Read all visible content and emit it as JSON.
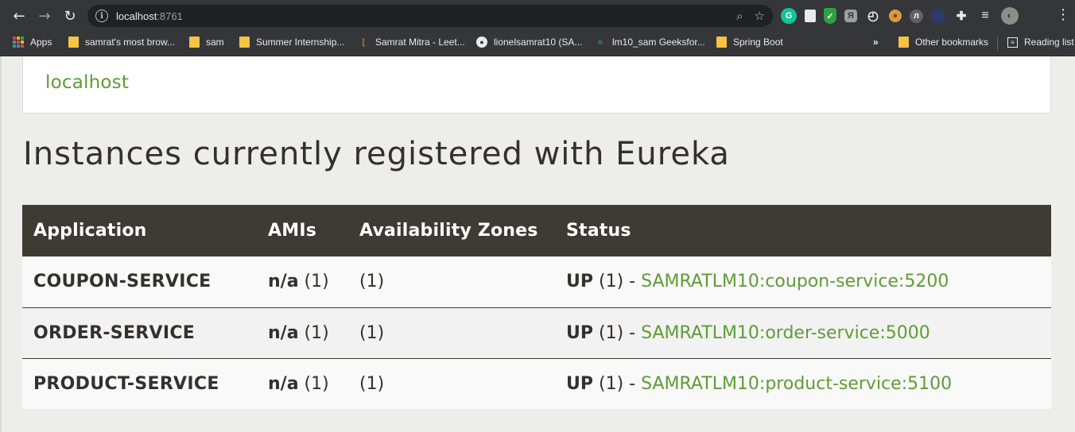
{
  "browser": {
    "url_host": "localhost",
    "url_port": ":8761",
    "extensions": [
      {
        "icon": "grammarly-icon",
        "color": "#15c39a",
        "glyph": "G"
      },
      {
        "icon": "notes-extension-icon",
        "color": "#e8eaed",
        "glyph": ""
      },
      {
        "icon": "shield-extension-icon",
        "color": "#2ea043",
        "glyph": "✓"
      },
      {
        "icon": "translate-extension-icon",
        "color": "#9aa0a6",
        "glyph": "Я"
      },
      {
        "icon": "timer-extension-icon",
        "color": "#bdc1c6",
        "glyph": "◴"
      },
      {
        "icon": "cookie-extension-icon",
        "color": "#d99a3a",
        "glyph": "●"
      },
      {
        "icon": "leetcode-extension-icon",
        "color": "#5f6368",
        "glyph": "л"
      },
      {
        "icon": "dark-extension-icon",
        "color": "#2b3a67",
        "glyph": ""
      },
      {
        "icon": "puzzle-extensions-icon",
        "color": "#35363a",
        "glyph": "✚"
      },
      {
        "icon": "reading-list-queue-icon",
        "color": "#35363a",
        "glyph": "≡"
      },
      {
        "icon": "profile-avatar-icon",
        "color": "#8a8f87",
        "glyph": "◐"
      }
    ]
  },
  "bookmarks": {
    "apps": "Apps",
    "items": [
      {
        "label": "samrat's most brow...",
        "icon": "folder"
      },
      {
        "label": "sam",
        "icon": "folder"
      },
      {
        "label": "Summer Internship...",
        "icon": "folder"
      },
      {
        "label": "Samrat Mitra - Leet...",
        "icon": "leetcode"
      },
      {
        "label": "lionelsamrat10 (SA...",
        "icon": "github"
      },
      {
        "label": "lm10_sam Geeksfor...",
        "icon": "geeksforgeeks"
      },
      {
        "label": "Spring Boot",
        "icon": "folder"
      }
    ],
    "overflow": "»",
    "other": "Other bookmarks",
    "reading_list": "Reading list"
  },
  "page": {
    "host_link": "localhost",
    "heading": "Instances currently registered with Eureka",
    "columns": [
      "Application",
      "AMIs",
      "Availability Zones",
      "Status"
    ],
    "rows": [
      {
        "application": "COUPON-SERVICE",
        "ami_label": "n/a",
        "ami_count": "(1)",
        "zones": "(1)",
        "status": "UP",
        "status_count": "(1) -",
        "instance": "SAMRATLM10:coupon-service:5200"
      },
      {
        "application": "ORDER-SERVICE",
        "ami_label": "n/a",
        "ami_count": "(1)",
        "zones": "(1)",
        "status": "UP",
        "status_count": "(1) -",
        "instance": "SAMRATLM10:order-service:5000"
      },
      {
        "application": "PRODUCT-SERVICE",
        "ami_label": "n/a",
        "ami_count": "(1)",
        "zones": "(1)",
        "status": "UP",
        "status_count": "(1) -",
        "instance": "SAMRATLM10:product-service:5100"
      }
    ]
  },
  "colors": {
    "link": "#5f9c35",
    "header_bg": "#3e3a34",
    "text": "#34302d"
  }
}
